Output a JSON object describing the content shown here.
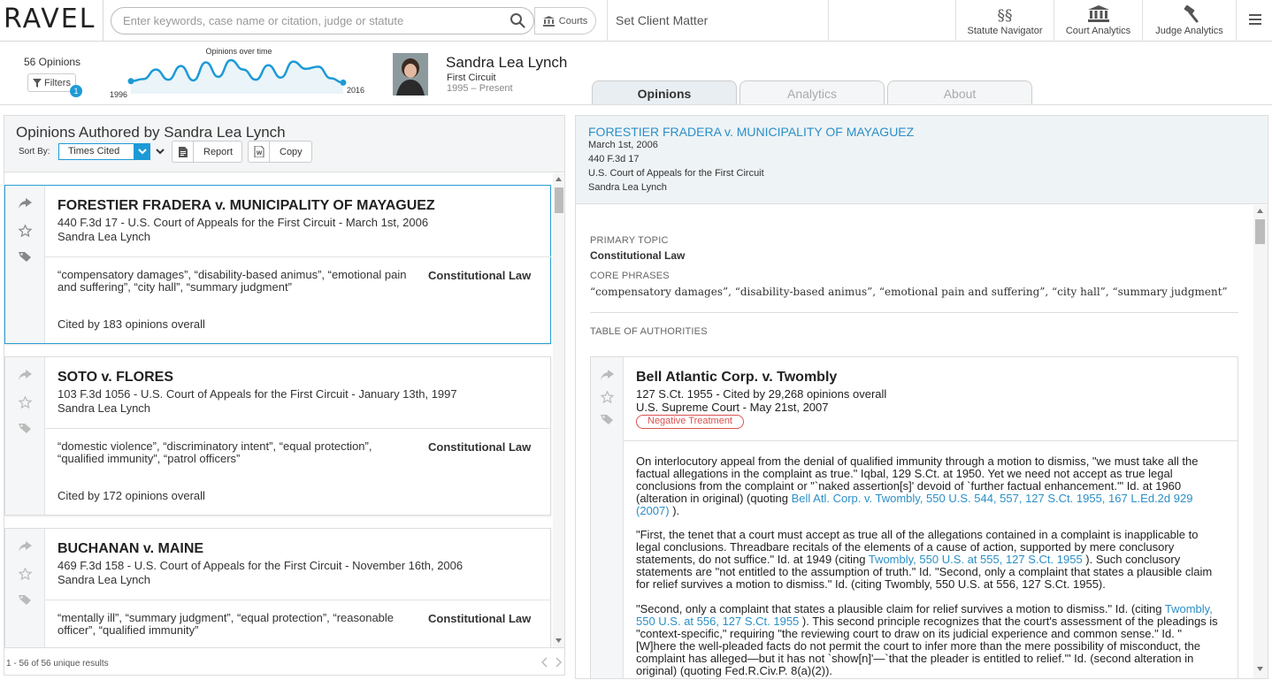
{
  "header": {
    "logo": "RAVEL",
    "search_placeholder": "Enter keywords, case name or citation, judge or statute",
    "courts_label": "Courts",
    "client_matter": "Set Client Matter",
    "tools": [
      {
        "label": "Statute Navigator",
        "icon": "section-icon"
      },
      {
        "label": "Court Analytics",
        "icon": "courthouse-icon"
      },
      {
        "label": "Judge Analytics",
        "icon": "gavel-icon"
      }
    ]
  },
  "judge": {
    "opinion_count": "56 Opinions",
    "filters_label": "Filters",
    "filter_badge": "1",
    "chart_title": "Opinions over time",
    "chart_start": "1996",
    "chart_end": "2016",
    "name": "Sandra Lea Lynch",
    "court": "First Circuit",
    "years": "1995 – Present"
  },
  "chart_data": {
    "type": "line",
    "title": "Opinions over time",
    "x_start": "1996",
    "x_end": "2016",
    "values": [
      1,
      1.3,
      2.6,
      1.2,
      3.1,
      1.1,
      3.6,
      1.6,
      3.9,
      2.6,
      1.2,
      3.2,
      1.5,
      3.7,
      2.7,
      3.0,
      1.4,
      0.8
    ],
    "accent": "#1d9ad6"
  },
  "tabs": [
    {
      "label": "Opinions",
      "active": true
    },
    {
      "label": "Analytics",
      "active": false
    },
    {
      "label": "About",
      "active": false
    }
  ],
  "left": {
    "title": "Opinions Authored by Sandra Lea Lynch",
    "sort_by_label": "Sort By:",
    "sort_value": "Times Cited",
    "report_label": "Report",
    "copy_label": "Copy",
    "results": [
      {
        "title": "FORESTIER FRADERA v. MUNICIPALITY OF MAYAGUEZ",
        "cite": "440 F.3d 17 - U.S. Court of Appeals for the First Circuit - March 1st, 2006",
        "judge": "Sandra Lea Lynch",
        "phrases": "“compensatory damages”, “disability-based animus”, “emotional pain and suffering”, “city hall”, “summary judgment”",
        "topic": "Constitutional Law",
        "cited": "Cited by 183 opinions overall"
      },
      {
        "title": "SOTO v. FLORES",
        "cite": "103 F.3d 1056 - U.S. Court of Appeals for the First Circuit - January 13th, 1997",
        "judge": "Sandra Lea Lynch",
        "phrases": "“domestic violence”, “discriminatory intent”, “equal protection”, “qualified immunity”, “patrol officers”",
        "topic": "Constitutional Law",
        "cited": "Cited by 172 opinions overall"
      },
      {
        "title": "BUCHANAN v. MAINE",
        "cite": "469 F.3d 158 - U.S. Court of Appeals for the First Circuit - November 16th, 2006",
        "judge": "Sandra Lea Lynch",
        "phrases": "“mentally ill”, “summary judgment”, “equal protection”, “reasonable officer”, “qualified immunity”",
        "topic": "Constitutional Law",
        "cited": ""
      }
    ],
    "results_count": "1 - 56 of 56 unique results"
  },
  "right": {
    "title": "FORESTIER FRADERA v. MUNICIPALITY OF MAYAGUEZ",
    "date": "March 1st, 2006",
    "reporter": "440 F.3d 17",
    "court": "U.S. Court of Appeals for the First Circuit",
    "judge": "Sandra Lea Lynch",
    "primary_topic_label": "PRIMARY TOPIC",
    "primary_topic": "Constitutional Law",
    "core_phrases_label": "CORE PHRASES",
    "core_phrases": "“compensatory damages”, “disability-based animus”, “emotional pain and suffering”, “city hall”, “summary judgment”",
    "toa_label": "TABLE OF AUTHORITIES",
    "authority": {
      "title": "Bell Atlantic Corp. v. Twombly",
      "cite": "127 S.Ct. 1955 - Cited by 29,268 opinions overall",
      "court": "U.S. Supreme Court - May 21st, 2007",
      "badge": "Negative Treatment",
      "p1_a": "On interlocutory appeal from the denial of qualified immunity through a motion to dismiss, \"we must take all the factual allegations in the complaint as true.\" Iqbal, 129 S.Ct. at 1950. Yet we need not accept as true legal conclusions from the complaint or \"`naked assertion[s]' devoid of `further factual enhancement.'\" Id. at 1960 (alteration in original) (quoting ",
      "p1_link": "Bell Atl. Corp. v. Twombly, 550 U.S. 544, 557, 127 S.Ct. 1955, 167 L.Ed.2d 929 (2007)",
      "p1_b": " ).",
      "p2_a": "\"First, the tenet that a court must accept as true all of the allegations contained in a complaint is inapplicable to legal conclusions. Threadbare recitals of the elements of a cause of action, supported by mere conclusory statements, do not suffice.\" Id. at 1949 (citing ",
      "p2_link": "Twombly, 550 U.S. at 555, 127 S.Ct. 1955",
      "p2_b": " ). Such conclusory statements are \"not entitled to the assumption of truth.\" Id. \"Second, only a complaint that states a plausible claim for relief survives a motion to dismiss.\" Id. (citing Twombly, 550 U.S. at 556, 127 S.Ct. 1955).",
      "p3_a": "\"Second, only a complaint that states a plausible claim for relief survives a motion to dismiss.\" Id. (citing ",
      "p3_link": "Twombly, 550 U.S. at 556, 127 S.Ct. 1955",
      "p3_b": " ). This second principle recognizes that the court's assessment of the pleadings is \"context-specific,\" requiring \"the reviewing court to draw on its judicial experience and common sense.\" Id. \"[W]here the well-pleaded facts do not permit the court to infer more than the mere possibility of misconduct, the complaint has alleged—but it has not `show[n]'—`that the pleader is entitled to relief.'\" Id. (second alteration in original) (quoting Fed.R.Civ.P. 8(a)(2))."
    }
  }
}
